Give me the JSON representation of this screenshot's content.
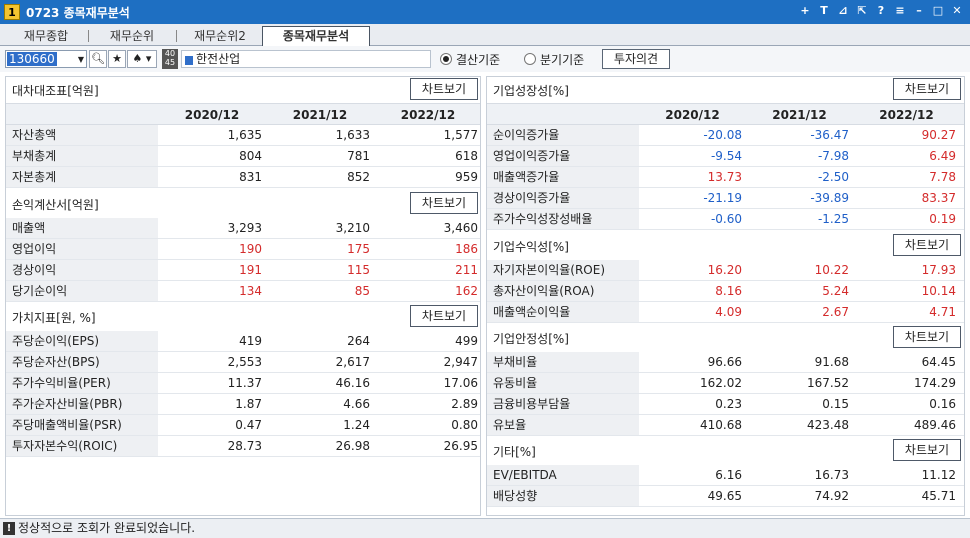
{
  "window": {
    "num_badge": "1",
    "title": "0723 종목재무분석",
    "icons": [
      "plus-icon",
      "text-icon",
      "link-icon",
      "export-icon",
      "help-icon",
      "menu-icon",
      "minimize-icon",
      "maximize-icon",
      "close-icon"
    ]
  },
  "tabs": [
    "재무종합",
    "재무순위",
    "재무순위2",
    "종목재무분석"
  ],
  "active_tab": 3,
  "toolbar": {
    "code": "130660",
    "stock_name": "한전산업",
    "box4045_top": "40",
    "box4045_bottom": "45",
    "radio_settle": "결산기준",
    "radio_quarter": "분기기준",
    "invest_btn": "투자의견"
  },
  "chart_btn": "차트보기",
  "years": [
    "2020/12",
    "2021/12",
    "2022/12"
  ],
  "left": {
    "balance": {
      "title": "대차대조표[억원]",
      "rows": [
        {
          "label": "자산총액",
          "v": [
            "1,635",
            "1,633",
            "1,577"
          ]
        },
        {
          "label": "부채총계",
          "v": [
            "804",
            "781",
            "618"
          ]
        },
        {
          "label": "자본총계",
          "v": [
            "831",
            "852",
            "959"
          ]
        }
      ]
    },
    "income": {
      "title": "손익계산서[억원]",
      "rows": [
        {
          "label": "매출액",
          "v": [
            "3,293",
            "3,210",
            "3,460"
          ]
        },
        {
          "label": "영업이익",
          "v": [
            "190",
            "175",
            "186"
          ]
        },
        {
          "label": "경상이익",
          "v": [
            "191",
            "115",
            "211"
          ]
        },
        {
          "label": "당기순이익",
          "v": [
            "134",
            "85",
            "162"
          ]
        }
      ]
    },
    "value": {
      "title": "가치지표[원, %]",
      "rows": [
        {
          "label": "주당순이익(EPS)",
          "v": [
            "419",
            "264",
            "499"
          ]
        },
        {
          "label": "주당순자산(BPS)",
          "v": [
            "2,553",
            "2,617",
            "2,947"
          ]
        },
        {
          "label": "주가수익비율(PER)",
          "v": [
            "11.37",
            "46.16",
            "17.06"
          ]
        },
        {
          "label": "주가순자산비율(PBR)",
          "v": [
            "1.87",
            "4.66",
            "2.89"
          ]
        },
        {
          "label": "주당매출액비율(PSR)",
          "v": [
            "0.47",
            "1.24",
            "0.80"
          ]
        },
        {
          "label": "투자자본수익(ROIC)",
          "v": [
            "28.73",
            "26.98",
            "26.95"
          ]
        }
      ]
    }
  },
  "right": {
    "growth": {
      "title": "기업성장성[%]",
      "rows": [
        {
          "label": "순이익증가율",
          "v": [
            "-20.08",
            "-36.47",
            "90.27"
          ]
        },
        {
          "label": "영업이익증가율",
          "v": [
            "-9.54",
            "-7.98",
            "6.49"
          ]
        },
        {
          "label": "매출액증가율",
          "v": [
            "13.73",
            "-2.50",
            "7.78"
          ]
        },
        {
          "label": "경상이익증가율",
          "v": [
            "-21.19",
            "-39.89",
            "83.37"
          ]
        },
        {
          "label": "주가수익성장성배율",
          "v": [
            "-0.60",
            "-1.25",
            "0.19"
          ]
        }
      ]
    },
    "profit": {
      "title": "기업수익성[%]",
      "rows": [
        {
          "label": "자기자본이익율(ROE)",
          "v": [
            "16.20",
            "10.22",
            "17.93"
          ]
        },
        {
          "label": "총자산이익율(ROA)",
          "v": [
            "8.16",
            "5.24",
            "10.14"
          ]
        },
        {
          "label": "매출액순이익율",
          "v": [
            "4.09",
            "2.67",
            "4.71"
          ]
        }
      ]
    },
    "stability": {
      "title": "기업안정성[%]",
      "rows": [
        {
          "label": "부채비율",
          "v": [
            "96.66",
            "91.68",
            "64.45"
          ]
        },
        {
          "label": "유동비율",
          "v": [
            "162.02",
            "167.52",
            "174.29"
          ]
        },
        {
          "label": "금융비용부담율",
          "v": [
            "0.23",
            "0.15",
            "0.16"
          ]
        },
        {
          "label": "유보율",
          "v": [
            "410.68",
            "423.48",
            "489.46"
          ]
        }
      ]
    },
    "etc": {
      "title": "기타[%]",
      "rows": [
        {
          "label": "EV/EBITDA",
          "v": [
            "6.16",
            "16.73",
            "11.12"
          ]
        },
        {
          "label": "배당성향",
          "v": [
            "49.65",
            "74.92",
            "45.71"
          ]
        }
      ]
    }
  },
  "colors": {
    "positive": "#d42b2b",
    "negative": "#1f5fc8",
    "neutral": "#222222"
  },
  "status": "정상적으로 조회가 완료되었습니다."
}
